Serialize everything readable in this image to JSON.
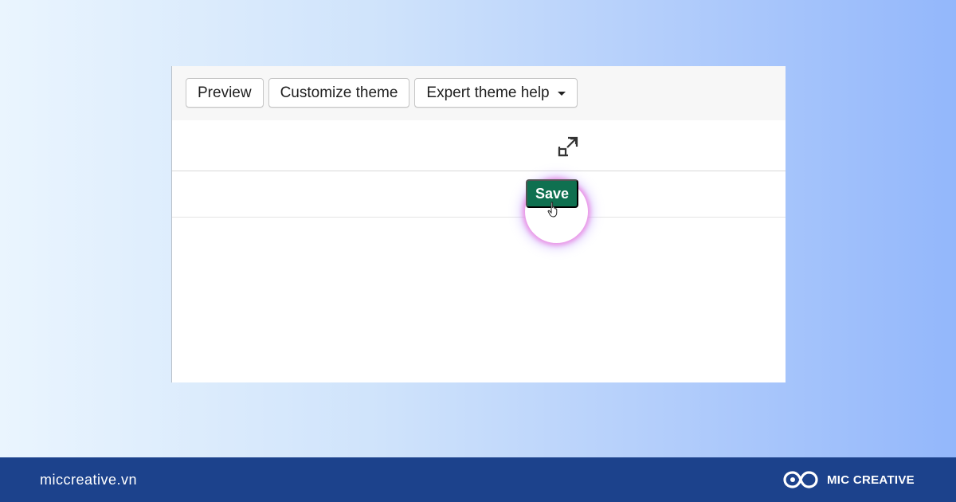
{
  "toolbar": {
    "preview_label": "Preview",
    "customize_label": "Customize theme",
    "expert_help_label": "Expert theme help"
  },
  "actions": {
    "save_label": "Save"
  },
  "icons": {
    "expand": "expand-icon",
    "dropdown": "chevron-down-icon",
    "cursor": "hand-pointer-icon",
    "logo": "infinity-logo-icon"
  },
  "footer": {
    "site": "miccreative.vn",
    "brand": "MIC CREATIVE"
  },
  "colors": {
    "save_button": "#0f7050",
    "footer_bar": "#1c428c",
    "glow": "#ec78dc"
  }
}
